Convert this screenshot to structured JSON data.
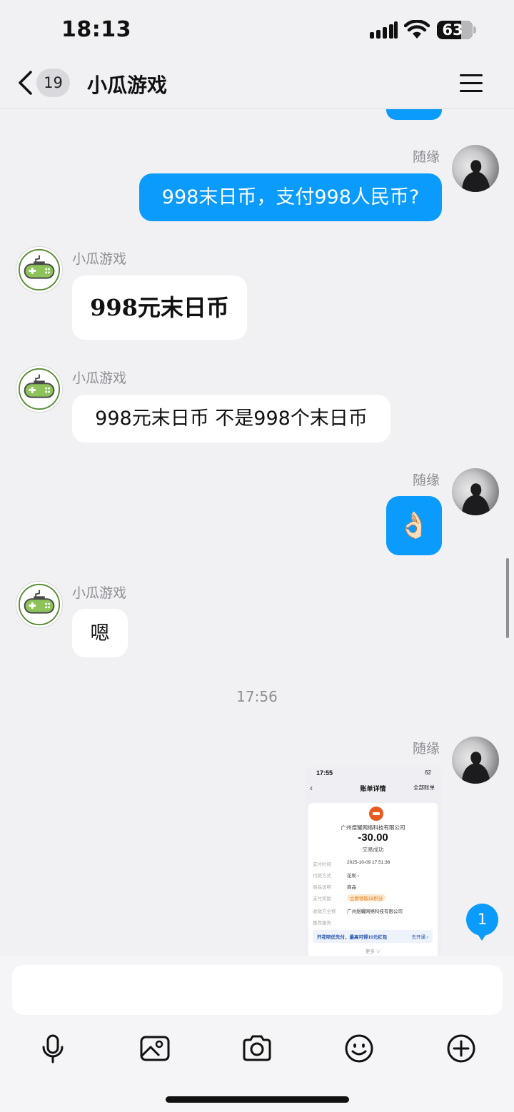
{
  "status_bar": {
    "time": "18:13",
    "battery": "63"
  },
  "header": {
    "unread_count": "19",
    "title": "小瓜游戏"
  },
  "messages": [
    {
      "sender": "随缘",
      "text": "998末日币，支付998人民币?"
    },
    {
      "sender": "小瓜游戏",
      "text": "998元末日币"
    },
    {
      "sender": "小瓜游戏",
      "text": "998元末日币 不是998个末日币"
    },
    {
      "sender": "随缘",
      "text": "👌🏻"
    },
    {
      "sender": "小瓜游戏",
      "text": "嗯"
    }
  ],
  "time_divider": "17:56",
  "receipt_message": {
    "sender": "随缘",
    "status_time": "17:55",
    "status_battery": "62",
    "title": "账单详情",
    "all_bills": "全部账单",
    "company": "广州煜耀网络科技有限公司",
    "amount": "-30.00",
    "result": "交易成功",
    "rows": [
      {
        "label": "支付时间",
        "value": "2025-10-09 17:51:36"
      },
      {
        "label": "付款方式",
        "value": "花呗 ›"
      },
      {
        "label": "商品说明",
        "value": "商品"
      },
      {
        "label": "支付奖励",
        "value": "立即领取15积分"
      },
      {
        "label": "收款方全称",
        "value": "广州煜耀网络科技有限公司"
      },
      {
        "label": "推荐服务",
        "value": ""
      }
    ],
    "promo_text": "开花呗优先付，最高可得10元红包",
    "promo_action": "去开通 ›",
    "more": "更多 ∨"
  },
  "new_message_count": "1",
  "input": {
    "placeholder": ""
  },
  "toolbar": [
    "microphone-icon",
    "image-icon",
    "camera-icon",
    "emoji-icon",
    "plus-icon"
  ],
  "colors": {
    "bubble_out": "#0a9bfc",
    "bubble_in": "#ffffff",
    "background": "#f1f1f3"
  }
}
